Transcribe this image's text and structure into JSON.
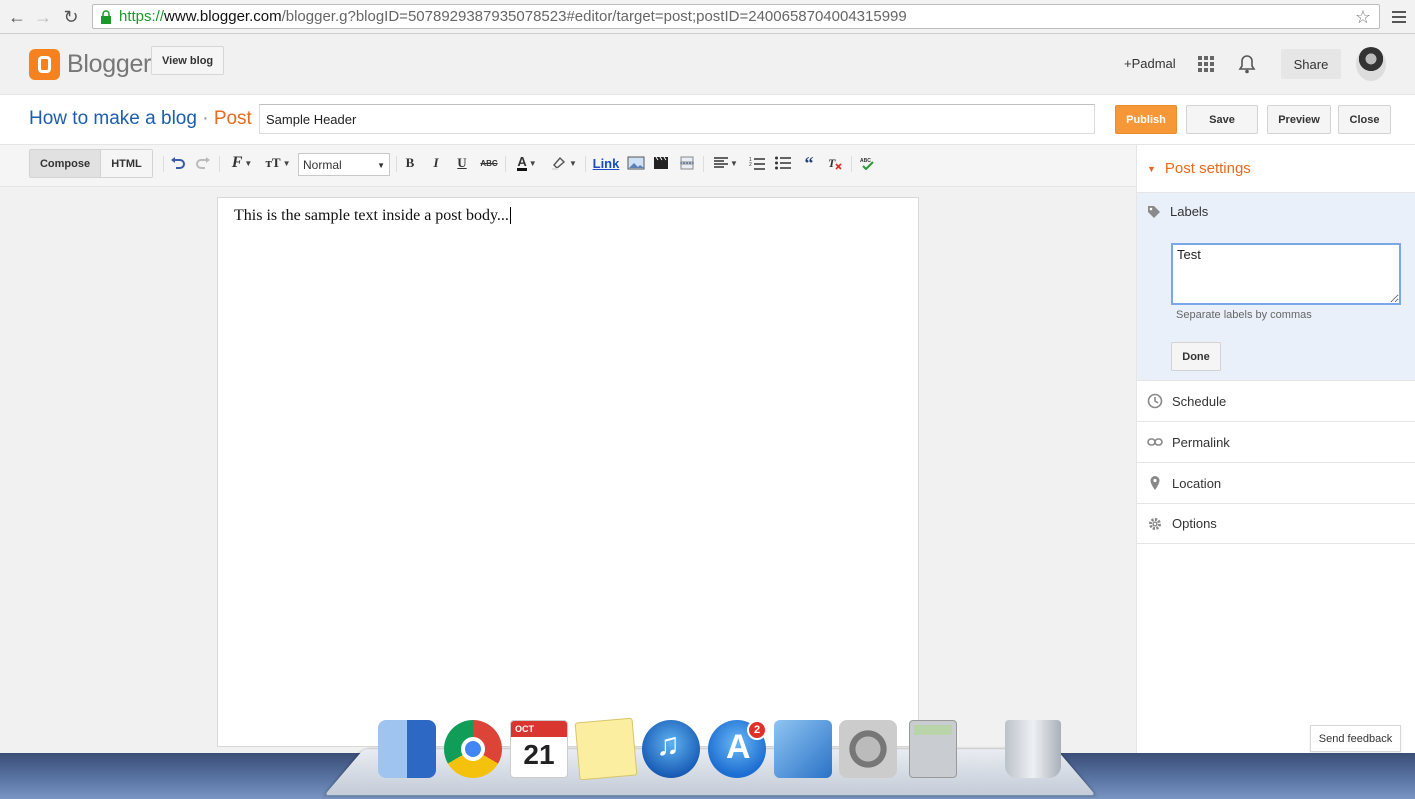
{
  "browser": {
    "url_scheme": "https://",
    "url_host": "www.blogger.com",
    "url_path": "/blogger.g?blogID=5078929387935078523#editor/target=post;postID=2400658704004315999"
  },
  "header": {
    "logo_text": "Blogger",
    "view_blog_label": "View blog",
    "user_label": "+Padmal",
    "share_label": "Share"
  },
  "post": {
    "blog_name": "How to make a blog",
    "separator": "·",
    "post_label": "Post",
    "title_value": "Sample Header",
    "publish_label": "Publish",
    "save_label": "Save",
    "preview_label": "Preview",
    "close_label": "Close"
  },
  "toolbar": {
    "compose_label": "Compose",
    "html_label": "HTML",
    "format_value": "Normal",
    "link_label": "Link"
  },
  "editor": {
    "body_text": "This is the sample text inside a post body..."
  },
  "sidebar": {
    "header": "Post settings",
    "labels_title": "Labels",
    "labels_value": "Test",
    "labels_hint": "Separate labels by commas",
    "done_label": "Done",
    "items": [
      {
        "label": "Schedule",
        "icon": "clock-icon"
      },
      {
        "label": "Permalink",
        "icon": "link-icon"
      },
      {
        "label": "Location",
        "icon": "pin-icon"
      },
      {
        "label": "Options",
        "icon": "gear-icon"
      }
    ]
  },
  "feedback_label": "Send feedback",
  "dock": {
    "calendar_month": "OCT",
    "calendar_day": "21",
    "appstore_badge": "2"
  },
  "colors": {
    "accent_orange": "#e76a1e",
    "publish_orange": "#f79838",
    "link_blue": "#1c5eab"
  }
}
